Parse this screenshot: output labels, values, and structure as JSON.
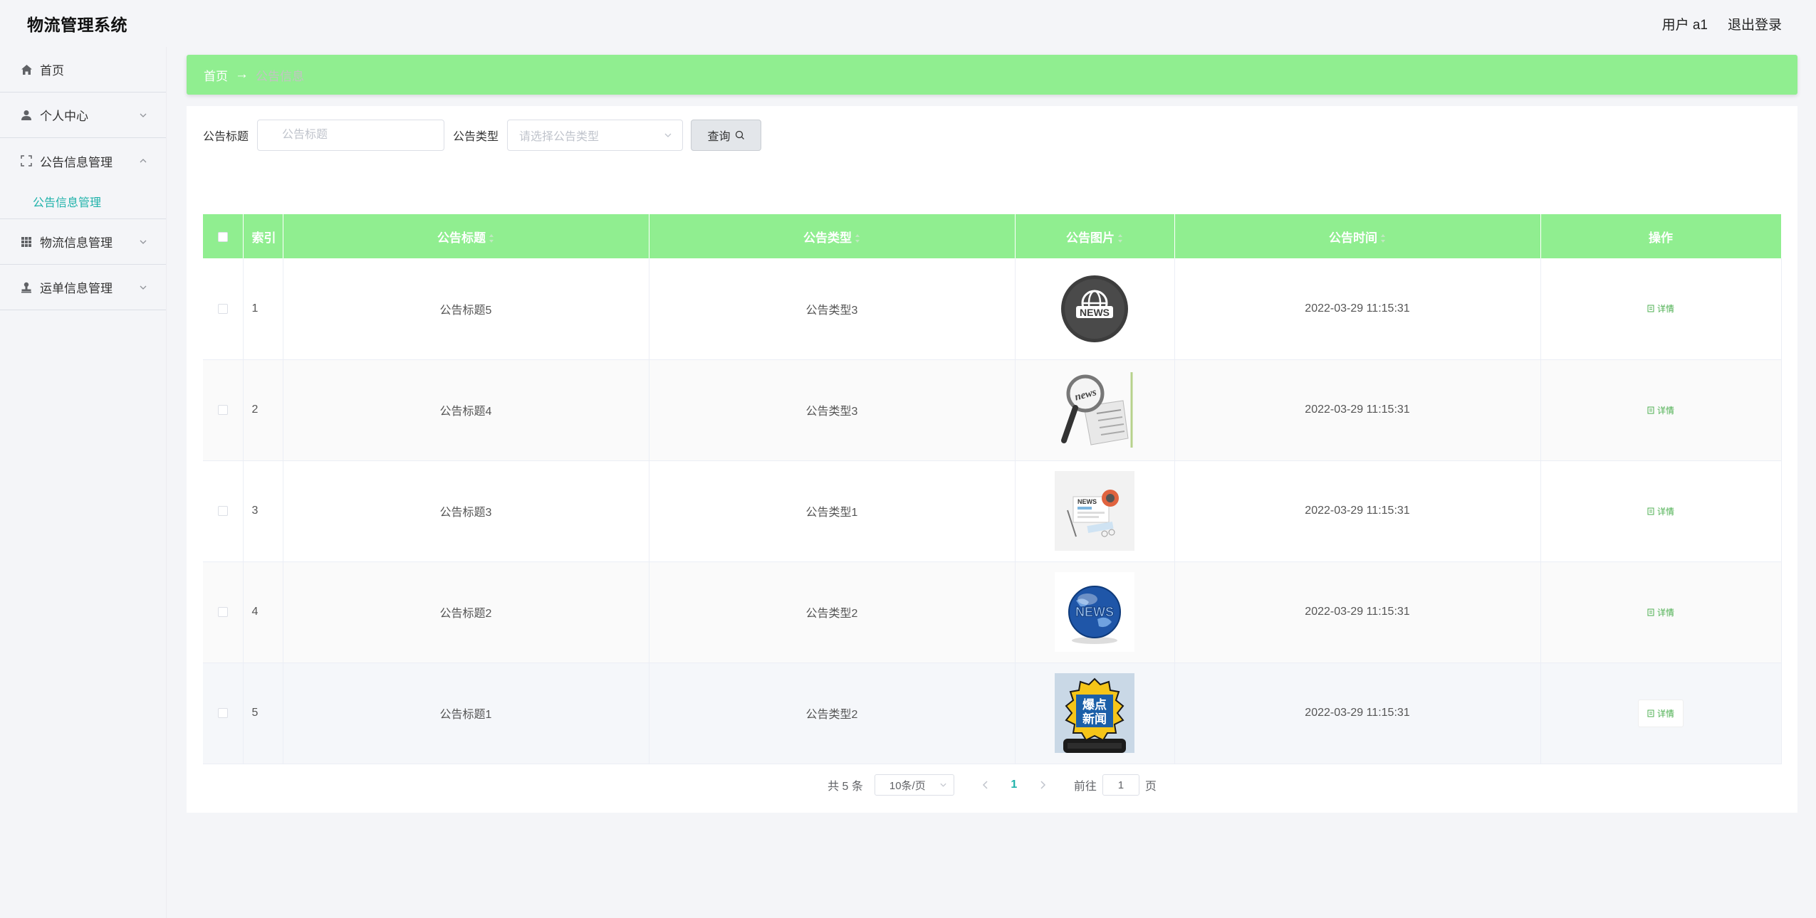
{
  "header": {
    "app_title": "物流管理系统",
    "user_label": "用户 a1",
    "logout_label": "退出登录"
  },
  "sidebar": {
    "items": [
      {
        "label": "首页",
        "icon": "home-icon"
      },
      {
        "label": "个人中心",
        "icon": "person-icon"
      },
      {
        "label": "公告信息管理",
        "icon": "expand-icon",
        "expanded": true,
        "children": [
          {
            "label": "公告信息管理"
          }
        ]
      },
      {
        "label": "物流信息管理",
        "icon": "grid-icon"
      },
      {
        "label": "运单信息管理",
        "icon": "stamp-icon"
      }
    ]
  },
  "breadcrumb": {
    "home": "首页",
    "separator": "→",
    "current": "公告信息"
  },
  "search": {
    "title_label": "公告标题",
    "title_placeholder": "公告标题",
    "type_label": "公告类型",
    "type_placeholder": "请选择公告类型",
    "query_button": "查询"
  },
  "table": {
    "columns": [
      "索引",
      "公告标题",
      "公告类型",
      "公告图片",
      "公告时间",
      "操作"
    ],
    "rows": [
      {
        "index": "1",
        "title": "公告标题5",
        "type": "公告类型3",
        "image": "news-globe-dark",
        "time": "2022-03-29 11:15:31",
        "action": "详情"
      },
      {
        "index": "2",
        "title": "公告标题4",
        "type": "公告类型3",
        "image": "news-magnifier",
        "time": "2022-03-29 11:15:31",
        "action": "详情"
      },
      {
        "index": "3",
        "title": "公告标题3",
        "type": "公告类型1",
        "image": "news-desk",
        "time": "2022-03-29 11:15:31",
        "action": "详情"
      },
      {
        "index": "4",
        "title": "公告标题2",
        "type": "公告类型2",
        "image": "news-globe-blue",
        "time": "2022-03-29 11:15:31",
        "action": "详情"
      },
      {
        "index": "5",
        "title": "公告标题1",
        "type": "公告类型2",
        "image": "breaking-news-badge",
        "time": "2022-03-29 11:15:31",
        "action": "详情"
      }
    ]
  },
  "pagination": {
    "total": "共 5 条",
    "page_size": "10条/页",
    "current_page": "1",
    "goto_prefix": "前往",
    "goto_value": "1",
    "goto_suffix": "页"
  },
  "colors": {
    "accent_green": "#90ee90",
    "link_teal": "#20b2aa",
    "detail_green": "#4caf50"
  }
}
